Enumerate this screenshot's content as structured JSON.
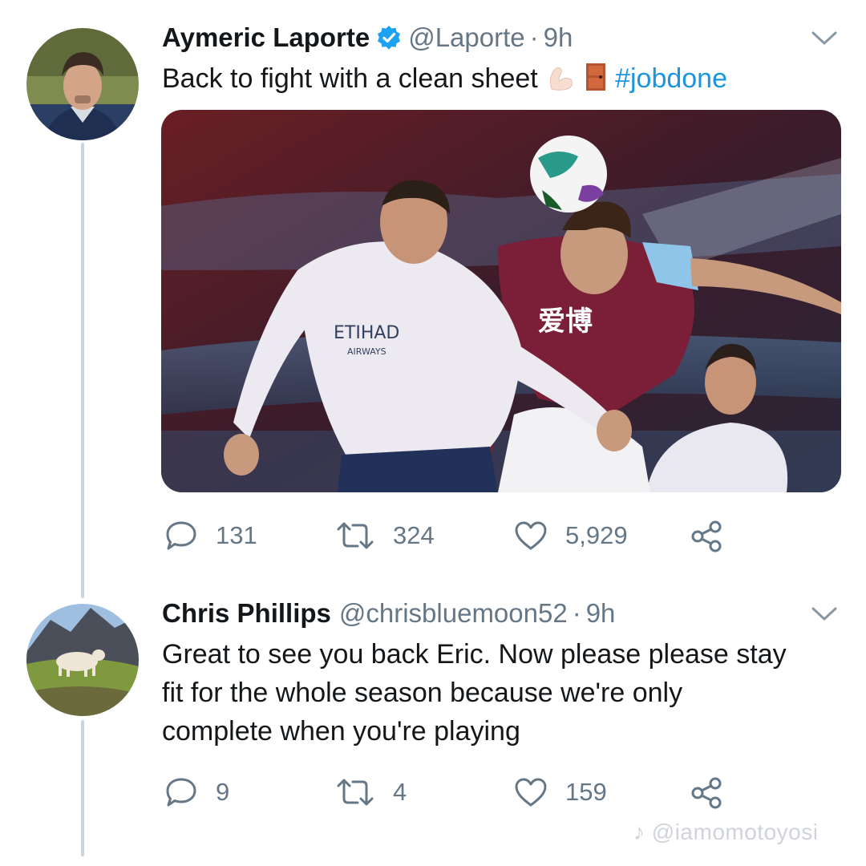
{
  "tweet": {
    "author_name": "Aymeric Laporte",
    "handle": "@Laporte",
    "separator": "·",
    "time": "9h",
    "text": "Back to fight with a clean sheet",
    "hashtag": "#jobdone",
    "emojis": [
      "flexed-biceps",
      "door"
    ],
    "replies": "131",
    "retweets": "324",
    "likes": "5,929"
  },
  "reply": {
    "author_name": "Chris Phillips",
    "handle": "@chrisbluemoon52",
    "separator": "·",
    "time": "9h",
    "text_lines": [
      "Great to see you back Eric. Now please please stay",
      "fit for the whole season because we're only",
      "complete when you're playing"
    ],
    "replies": "9",
    "retweets": "4",
    "likes": "159"
  },
  "watermark": "@iamomotoyosi",
  "colors": {
    "hashtag": "#1b95e0",
    "secondary_text": "#657786",
    "verified_badge": "#1da1f2",
    "thread_line": "#c9d3db"
  }
}
